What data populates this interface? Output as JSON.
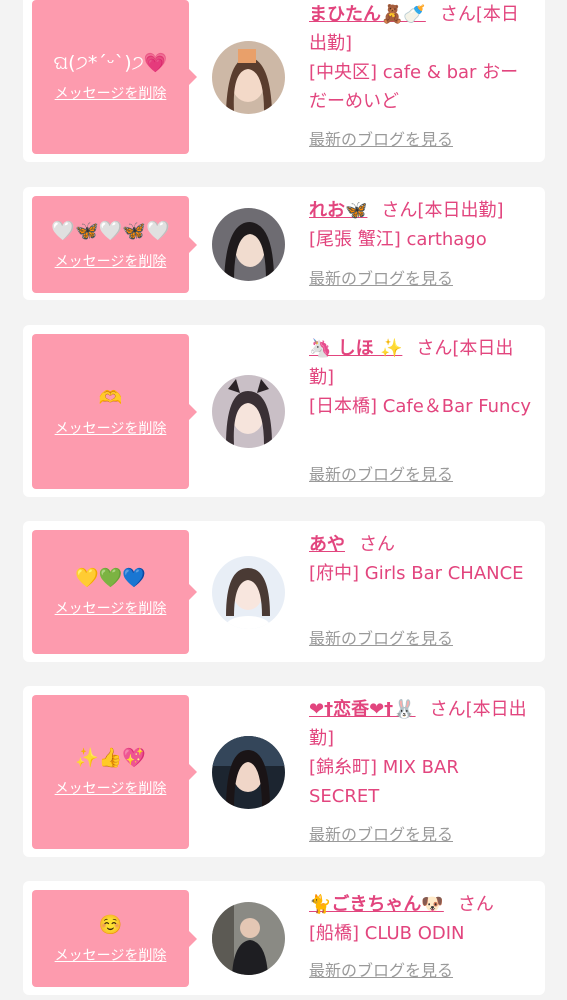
{
  "colors": {
    "background": "#f3f3f3",
    "card": "#ffffff",
    "bubble": "#fd9bae",
    "accent_text": "#e2457e",
    "link_gray": "#9a9a9a"
  },
  "labels": {
    "delete_message": "メッセージを削除",
    "latest_blog": "最新のブログを見る"
  },
  "conversations": [
    {
      "message": "ଘ(੭*ˊᵕˋ)੭💗",
      "name": "まひたん🧸🍼",
      "honorific": "さん",
      "status": "[本日出勤]",
      "venue": "[中央区] cafe & bar おーだーめいど",
      "avatar_icon": "girl-portrait-photo"
    },
    {
      "message": "🤍🦋🤍🦋🤍",
      "name": "れお🦋",
      "honorific": "さん",
      "status": "[本日出勤]",
      "venue": "[尾張 蟹江] carthago",
      "avatar_icon": "girl-portrait-photo"
    },
    {
      "message": "🫶",
      "name": "🦄 しほ ✨",
      "honorific": "さん",
      "status": "[本日出勤]",
      "venue": "[日本橋] Cafe＆Bar Funcy",
      "avatar_icon": "girl-portrait-photo"
    },
    {
      "message": "💛💚💙",
      "name": "あや",
      "honorific": "さん",
      "status": "",
      "venue": "[府中] Girls Bar CHANCE",
      "avatar_icon": "girl-portrait-photo"
    },
    {
      "message": "✨👍💖",
      "name": "❤︎†恋香❤︎†🐰",
      "honorific": "さん",
      "status": "[本日出勤]",
      "venue": "[錦糸町] MIX BAR SECRET",
      "avatar_icon": "girl-portrait-photo"
    },
    {
      "message": "☺️",
      "name": "🐈ごきちゃん🐶",
      "honorific": "さん",
      "status": "",
      "venue": "[船橋] CLUB ODIN",
      "avatar_icon": "person-portrait-photo"
    }
  ]
}
